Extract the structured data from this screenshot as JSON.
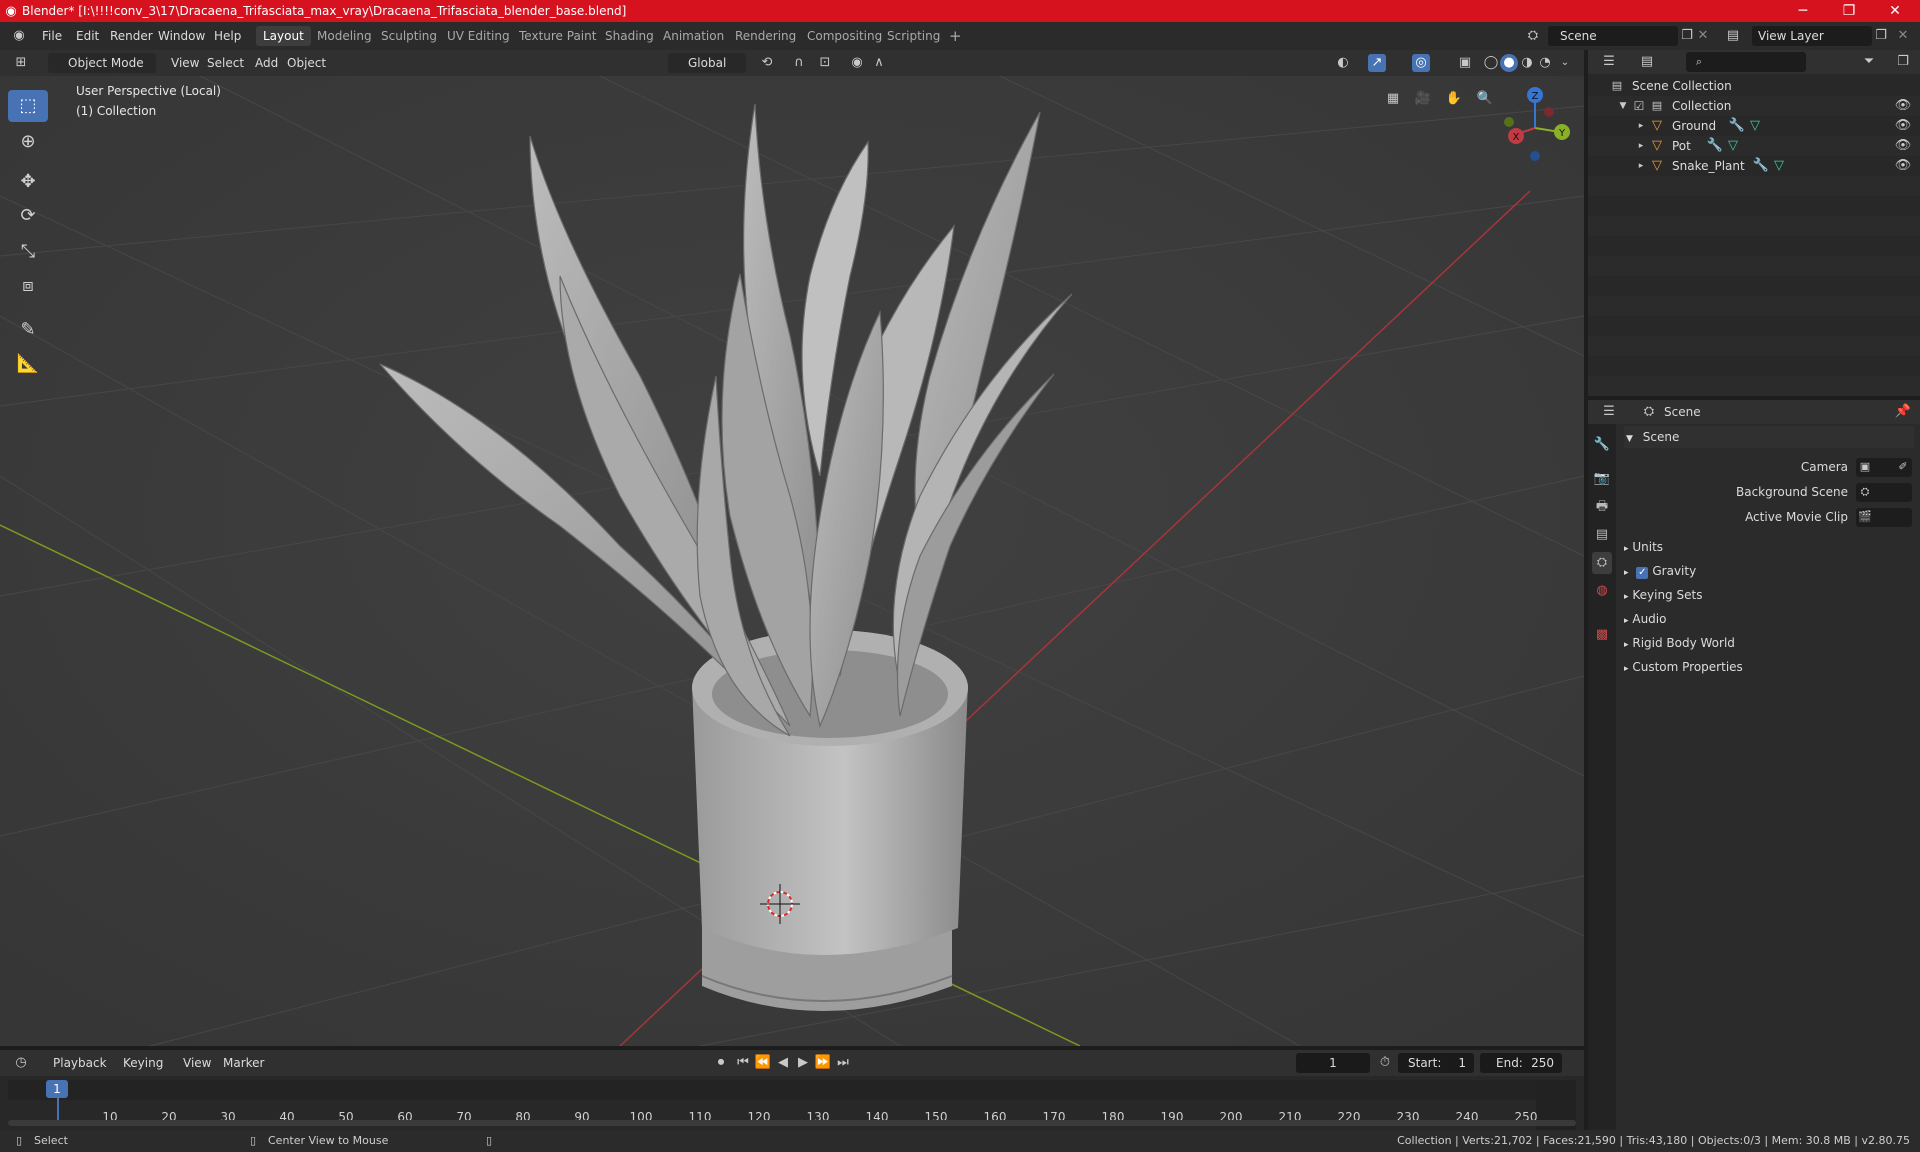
{
  "titlebar": {
    "title": "Blender* [I:\\!!!!conv_3\\17\\Dracaena_Trifasciata_max_vray\\Dracaena_Trifasciata_blender_base.blend]",
    "minimize": "─",
    "maximize": "❐",
    "close": "✕"
  },
  "menu": [
    "File",
    "Edit",
    "Render",
    "Window",
    "Help"
  ],
  "workspaces": [
    "Layout",
    "Modeling",
    "Sculpting",
    "UV Editing",
    "Texture Paint",
    "Shading",
    "Animation",
    "Rendering",
    "Compositing",
    "Scripting"
  ],
  "workspace_add": "+",
  "scene_field": "Scene",
  "view_layer_field": "View Layer",
  "viewport_header": {
    "mode": "Object Mode",
    "view": "View",
    "select": "Select",
    "add": "Add",
    "object": "Object",
    "orientation": "Global"
  },
  "viewport": {
    "perspective": "User Perspective (Local)",
    "collection": "(1) Collection",
    "gizmo": {
      "z": "Z",
      "y": "Y",
      "x": "X"
    }
  },
  "outliner": {
    "root": "Scene Collection",
    "collection": "Collection",
    "items": [
      "Ground",
      "Pot",
      "Snake_Plant"
    ]
  },
  "properties": {
    "context": "Scene",
    "panel": "Scene",
    "camera_label": "Camera",
    "background_label": "Background Scene",
    "movieclip_label": "Active Movie Clip",
    "sections": [
      "Units",
      "Gravity",
      "Keying Sets",
      "Audio",
      "Rigid Body World",
      "Custom Properties"
    ]
  },
  "timeline": {
    "playback": "Playback",
    "keying": "Keying",
    "view": "View",
    "marker": "Marker",
    "current_frame": "1",
    "start_label": "Start:",
    "start": "1",
    "end_label": "End:",
    "end": "250",
    "ticks": [
      "10",
      "20",
      "30",
      "40",
      "50",
      "60",
      "70",
      "80",
      "90",
      "100",
      "110",
      "120",
      "130",
      "140",
      "150",
      "160",
      "170",
      "180",
      "190",
      "200",
      "210",
      "220",
      "230",
      "240",
      "250"
    ],
    "playhead": "1"
  },
  "status": {
    "select": "Select",
    "center": "Center View to Mouse",
    "stats": "Collection | Verts:21,702 | Faces:21,590 | Tris:43,180 | Objects:0/3 | Mem: 30.8 MB | v2.80.75"
  },
  "colors": {
    "title_bar": "#d6121f",
    "accent": "#4772b3",
    "x_axis": "#c23b44",
    "y_axis": "#8ab027",
    "z_axis": "#3575d6"
  }
}
